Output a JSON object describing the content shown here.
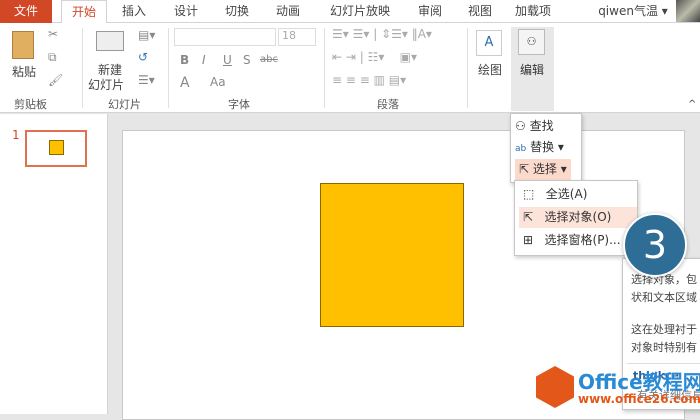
{
  "tabs": [
    "文件",
    "开始",
    "插入",
    "设计",
    "切换",
    "动画",
    "幻灯片放映",
    "审阅",
    "视图",
    "加载项"
  ],
  "user": "qiwen气温",
  "ribbon": {
    "clipboard": {
      "paste": "粘贴",
      "label": "剪贴板"
    },
    "slides": {
      "new_slide_1": "新建",
      "new_slide_2": "幻灯片",
      "label": "幻灯片"
    },
    "font": {
      "size": "18",
      "label": "字体",
      "bold": "B",
      "italic": "I",
      "underline": "U",
      "shadow": "S",
      "strike": "abc",
      "grow": "A",
      "aa": "Aa"
    },
    "paragraph": {
      "label": "段落"
    },
    "drawing": {
      "label": "绘图"
    },
    "editing": {
      "label": "编辑"
    }
  },
  "thumbnail": {
    "number": "1"
  },
  "edit_menu": {
    "find": "查找",
    "replace": "替换",
    "select": "选择"
  },
  "select_menu": {
    "items": [
      "全选(A)",
      "选择对象(O)",
      "选择窗格(P)..."
    ]
  },
  "step_badge": "3",
  "tooltip": {
    "lines": [
      "选择对象，包",
      "状和文本区域",
      "这在处理衬于",
      "对象时特别有"
    ],
    "footer": "thinkce",
    "footer2": "有关详细信息"
  },
  "watermark": {
    "title": "Office教程网",
    "url": "www.office26.com"
  },
  "colors": {
    "accent": "#d24726",
    "shape": "#ffc000",
    "badge": "#2e6e96"
  }
}
